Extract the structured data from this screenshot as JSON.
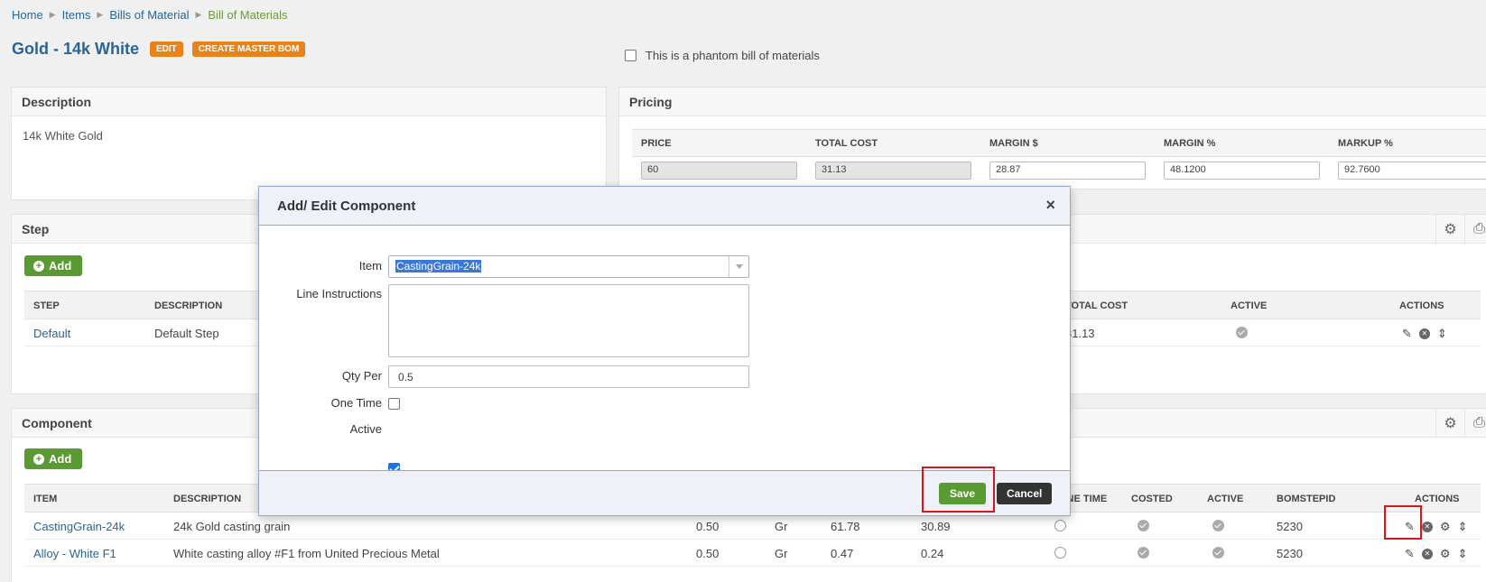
{
  "breadcrumb": [
    "Home",
    "Items",
    "Bills of Material",
    "Bill of Materials"
  ],
  "page": {
    "title": "Gold - 14k White",
    "edit_badge": "EDIT",
    "master_badge": "CREATE MASTER BOM",
    "phantom_label": "This is a phantom bill of materials"
  },
  "description": {
    "title": "Description",
    "text": "14k White Gold"
  },
  "pricing": {
    "title": "Pricing",
    "headers": [
      "PRICE",
      "TOTAL COST",
      "MARGIN $",
      "MARGIN %",
      "MARKUP %"
    ],
    "values": [
      "60",
      "31.13",
      "28.87",
      "48.1200",
      "92.7600"
    ]
  },
  "step": {
    "title": "Step",
    "add_label": "Add",
    "headers": {
      "step": "STEP",
      "description": "DESCRIPTION",
      "total_cost": "TOTAL COST",
      "active": "ACTIVE",
      "actions": "ACTIONS"
    },
    "rows": [
      {
        "step": "Default",
        "description": "Default Step",
        "total_cost": "31.13"
      }
    ]
  },
  "component": {
    "title": "Component",
    "add_label": "Add",
    "headers": {
      "item": "ITEM",
      "description": "DESCRIPTION",
      "one_time": "ONE TIME",
      "costed": "COSTED",
      "active": "ACTIVE",
      "bomstepid": "BOMSTEPID",
      "actions": "ACTIONS"
    },
    "rows": [
      {
        "item": "CastingGrain-24k",
        "description": "24k Gold casting grain",
        "qty": "0.50",
        "uom": "Gr",
        "unit_cost": "61.78",
        "ext_cost": "30.89",
        "bomstepid": "5230"
      },
      {
        "item": "Alloy - White F1",
        "description": "White casting alloy #F1 from United Precious Metal",
        "qty": "0.50",
        "uom": "Gr",
        "unit_cost": "0.47",
        "ext_cost": "0.24",
        "bomstepid": "5230"
      }
    ]
  },
  "modal": {
    "title": "Add/ Edit Component",
    "item_label": "Item",
    "item_value": "CastingGrain-24k",
    "line_instructions_label": "Line Instructions",
    "qty_label": "Qty Per",
    "qty_value": "0.5",
    "one_time_label": "One Time",
    "active_label": "Active",
    "save_label": "Save",
    "cancel_label": "Cancel"
  },
  "colors": {
    "accent": "#2a6496",
    "green": "#5a9a33",
    "orange": "#e8831a",
    "highlight": "#d9141b"
  }
}
